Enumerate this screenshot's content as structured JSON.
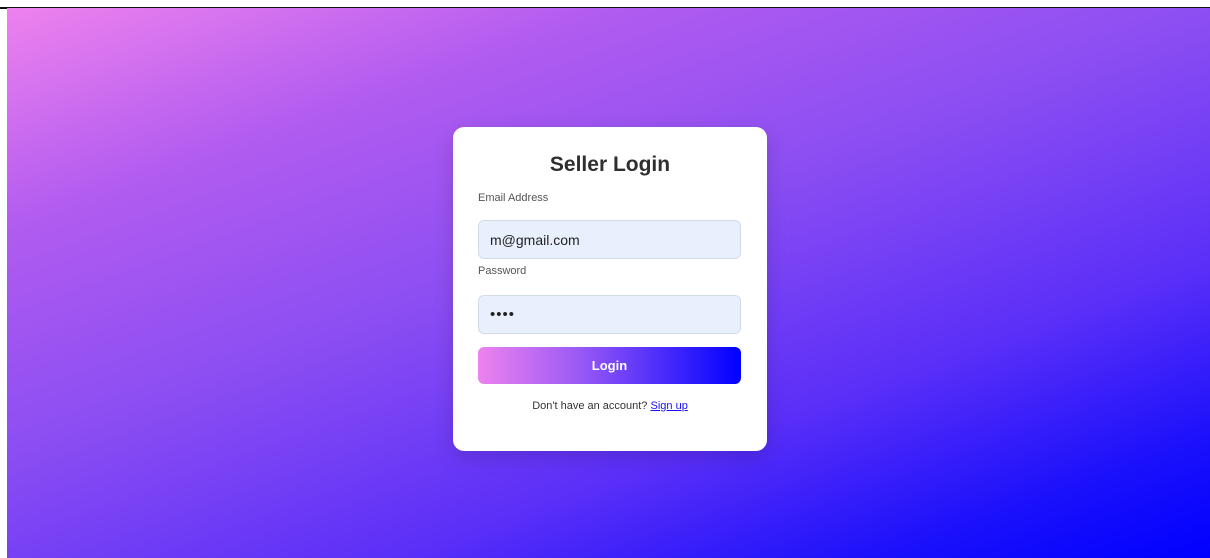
{
  "login": {
    "title": "Seller Login",
    "email_label": "Email Address",
    "email_value": "m@gmail.com",
    "password_label": "Password",
    "password_value": "••••",
    "login_button": "Login",
    "signup_prompt": "Don't have an account?",
    "signup_link": "Sign up"
  },
  "colors": {
    "background_start": "#ee82ee",
    "background_end": "#0000ff",
    "input_background": "#e8f0fe",
    "card_background": "#ffffff"
  }
}
